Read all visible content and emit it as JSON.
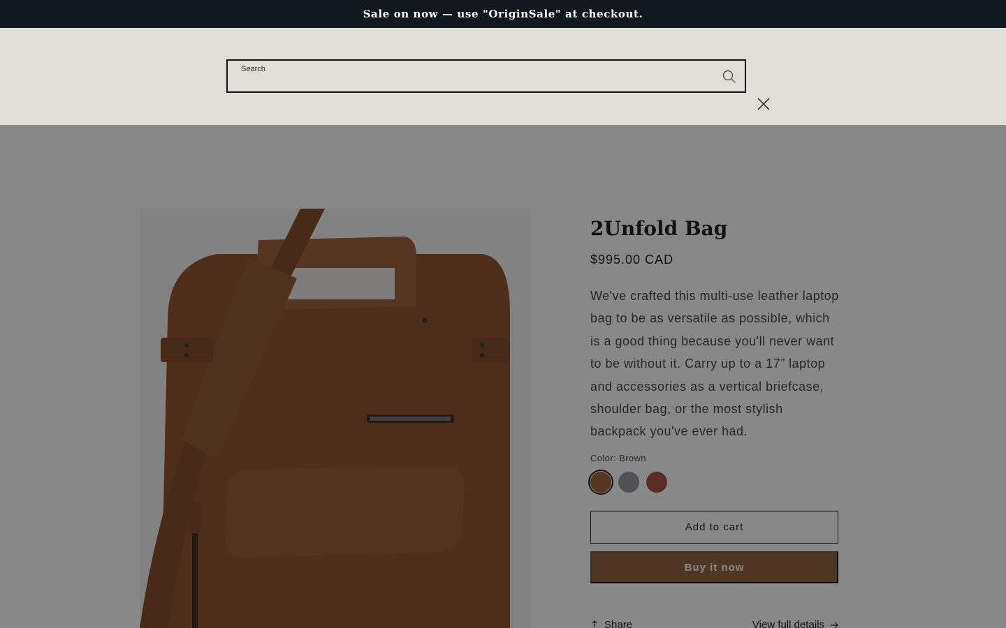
{
  "announcement": {
    "text": "Sale on now — use \"OriginSale\" at checkout."
  },
  "search": {
    "label": "Search",
    "value": "",
    "placeholder": "Search",
    "submit_icon": "search-icon",
    "close_icon": "close-icon"
  },
  "product": {
    "title": "2Unfold Bag",
    "price": "$995.00 CAD",
    "description": "We've crafted this multi-use leather laptop bag to be as versatile as possible, which is a good thing because you'll never want to be without it. Carry up to a 17” laptop and accessories as a vertical briefcase, shoulder bag, or the most stylish backpack you've ever had.",
    "color_label": "Color: Brown",
    "swatches": [
      {
        "color": "#9a5a34",
        "selected": true
      },
      {
        "color": "#8f9196",
        "selected": false
      },
      {
        "color": "#a0493a",
        "selected": false
      }
    ],
    "add_to_cart_label": "Add to cart",
    "buy_now_label": "Buy it now",
    "share_label": "Share",
    "view_details_label": "View full details"
  },
  "colors": {
    "announcement_bg": "#111820",
    "search_bg": "#dfdfd8",
    "buy_now_bg": "#8c5b33",
    "overlay": "rgba(18,18,18,0.5)"
  }
}
